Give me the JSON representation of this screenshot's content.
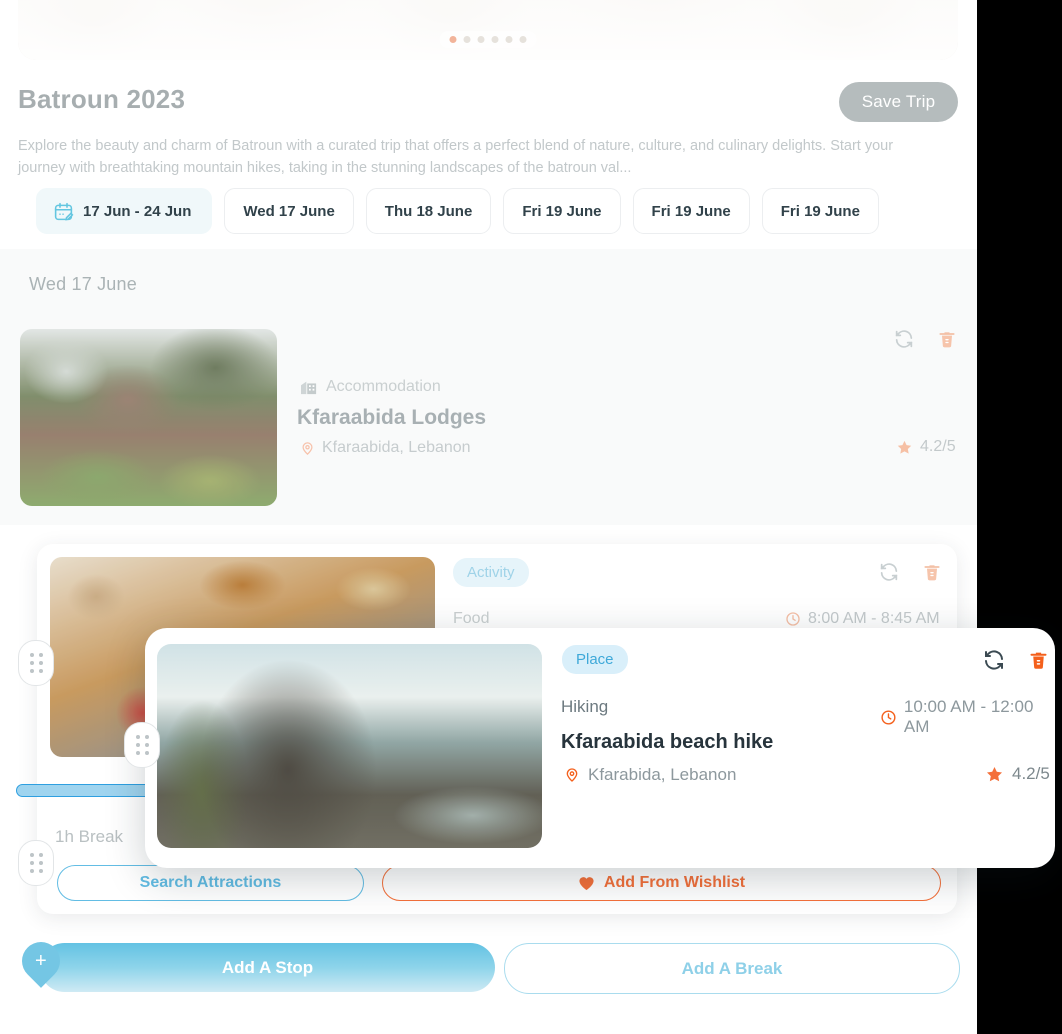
{
  "hero": {
    "carousel_dots": 6,
    "active_dot_index": 0,
    "active_dot_color": "#f2b49a",
    "inactive_dot_color": "#e6e2dc"
  },
  "header": {
    "title": "Batroun 2023",
    "save_label": "Save Trip",
    "description": "Explore the beauty and charm of Batroun with a curated trip that offers a perfect blend of nature, culture, and culinary delights. Start your journey with breathtaking mountain hikes, taking in the stunning landscapes of the batroun val..."
  },
  "tabs": [
    {
      "label": "17 Jun - 24 Jun",
      "icon": "calendar-edit-icon",
      "active": true
    },
    {
      "label": "Wed 17 June",
      "active": false
    },
    {
      "label": "Thu 18 June",
      "active": false
    },
    {
      "label": "Fri 19 June",
      "active": false
    },
    {
      "label": "Fri 19 June",
      "active": false
    },
    {
      "label": "Fri 19 June",
      "active": false
    }
  ],
  "day": {
    "label": "Wed 17 June"
  },
  "accommodation": {
    "type": "Accommodation",
    "type_icon": "hotel-icon",
    "name": "Kfaraabida Lodges",
    "location": "Kfaraabida, Lebanon",
    "location_icon": "map-pin-icon",
    "rating": "4.2/5",
    "rating_icon": "star-icon",
    "refresh_icon": "refresh-icon",
    "delete_icon": "trash-icon"
  },
  "activity": {
    "badge": "Activity",
    "category": "Food",
    "time": "8:00 AM - 8:45 AM",
    "time_icon": "clock-icon",
    "refresh_icon": "refresh-icon",
    "delete_icon": "trash-icon"
  },
  "break_item": {
    "label": "1h Break"
  },
  "card_actions": {
    "search_label": "Search Attractions",
    "wishlist_label": "Add From Wishlist",
    "wishlist_icon": "heart-icon"
  },
  "place_card": {
    "badge": "Place",
    "category": "Hiking",
    "time": "10:00 AM - 12:00 AM",
    "time_icon": "clock-icon",
    "title": "Kfaraabida beach hike",
    "location": "Kfarabida, Lebanon",
    "location_icon": "map-pin-icon",
    "rating": "4.2/5",
    "rating_icon": "star-icon",
    "refresh_icon": "refresh-icon",
    "delete_icon": "trash-icon"
  },
  "bottom_bar": {
    "add_stop_label": "Add A Stop",
    "add_break_label": "Add A Break",
    "add_icon": "plus-pin-icon"
  },
  "colors": {
    "accent_blue": "#2e9fe0",
    "light_blue": "#63bde4",
    "accent_orange": "#f4703a",
    "muted_text": "#c2c8ca",
    "dark_text": "#27343c"
  }
}
